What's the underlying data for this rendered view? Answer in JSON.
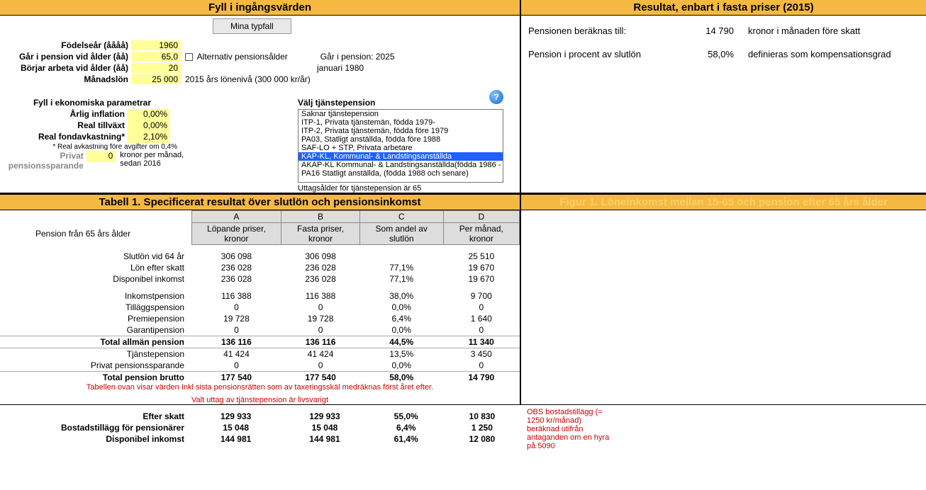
{
  "header_left": "Fyll i ingångsvärden",
  "header_right": "Resultat, enbart i fasta priser (2015)",
  "btn_typfall": "Mina typfall",
  "inputs": {
    "birth_label": "Födelseår (åååå)",
    "birth_value": "1960",
    "retire_age_label": "Går i pension vid ålder (åå)",
    "retire_age_value": "65,0",
    "alt_age_label": "Alternativ pensionsålder",
    "retire_year_label": "Går i pension: 2025",
    "work_age_label": "Börjar arbeta vid ålder (åå)",
    "work_age_value": "20",
    "work_start_note": "januari 1980",
    "salary_label": "Månadslön",
    "salary_value": "25 000",
    "salary_note": "2015 års lönenivå (300 000 kr/år)"
  },
  "params_header": "Fyll i ekonomiska parametrar",
  "params": {
    "inflation_label": "Årlig inflation",
    "inflation_value": "0,00%",
    "growth_label": "Real tillväxt",
    "growth_value": "0,00%",
    "fund_label": "Real fondavkastning*",
    "fund_value": "2,10%",
    "fund_note": "* Real avkastning före avgifter om 0,4%",
    "private_label": "Privat pensionssparande",
    "private_value": "0",
    "private_note": "kronor per månad, sedan 2016"
  },
  "tp_header": "Välj tjänstepension",
  "tp_items": [
    "Saknar tjänstepension",
    "ITP-1, Privata tjänstemän, födda 1979-",
    "ITP-2, Privata tjänstemän, födda före 1979",
    "PA03, Statligt anställda, födda före 1988",
    "SAF-LO + STP, Privata arbetare",
    "KAP-KL, Kommunal- & Landstingsanställda",
    "AKAP-KL Kommunal- & Landstingsanställda(födda 1986 -",
    "PA16 Statligt anställda, (födda 1988 och senare)"
  ],
  "tp_selected_index": 5,
  "tp_note": "Uttagsålder för tjänstepension är 65",
  "results": {
    "r1_label": "Pensionen beräknas till:",
    "r1_value": "14 790",
    "r1_desc": "kronor i månaden före skatt",
    "r2_label": "Pension i procent av slutlön",
    "r2_value": "58,0%",
    "r2_desc": "definieras som kompensationsgrad"
  },
  "table_header": "Tabell 1. Specificerat resultat över slutlön och pensionsinkomst",
  "figure_header": "Figur 1. Löneinkomst mellan 15-65 och pension efter 65  års ålder",
  "cols": {
    "a": "A",
    "b": "B",
    "c": "C",
    "d": "D",
    "a2": "Löpande priser, kronor",
    "b2": "Fasta priser, kronor",
    "c2": "Som andel av slutlön",
    "d2": "Per månad, kronor",
    "rowhead": "Pension från 65 års ålder"
  },
  "rows": {
    "slutlon": {
      "lbl": "Slutlön vid 64 år",
      "a": "306 098",
      "b": "306 098",
      "c": "",
      "d": "25 510"
    },
    "lon_skatt": {
      "lbl": "Lön efter skatt",
      "a": "236 028",
      "b": "236 028",
      "c": "77,1%",
      "d": "19 670"
    },
    "disp1": {
      "lbl": "Disponibel inkomst",
      "a": "236 028",
      "b": "236 028",
      "c": "77,1%",
      "d": "19 670"
    },
    "inkomst": {
      "lbl": "Inkomstpension",
      "a": "116 388",
      "b": "116 388",
      "c": "38,0%",
      "d": "9 700"
    },
    "tillagg": {
      "lbl": "Tilläggspension",
      "a": "0",
      "b": "0",
      "c": "0,0%",
      "d": "0"
    },
    "premie": {
      "lbl": "Premiepension",
      "a": "19 728",
      "b": "19 728",
      "c": "6,4%",
      "d": "1 640"
    },
    "garanti": {
      "lbl": "Garantipension",
      "a": "0",
      "b": "0",
      "c": "0,0%",
      "d": "0"
    },
    "tot_allman": {
      "lbl": "Total allmän pension",
      "a": "136 116",
      "b": "136 116",
      "c": "44,5%",
      "d": "11 340"
    },
    "tjanste": {
      "lbl": "Tjänstepension",
      "a": "41 424",
      "b": "41 424",
      "c": "13,5%",
      "d": "3 450"
    },
    "privat": {
      "lbl": "Privat pensionssparande",
      "a": "0",
      "b": "0",
      "c": "0,0%",
      "d": "0"
    },
    "tot_brutto": {
      "lbl": "Total pension brutto",
      "a": "177 540",
      "b": "177 540",
      "c": "58,0%",
      "d": "14 790"
    },
    "efter_skatt": {
      "lbl": "Efter skatt",
      "a": "129 933",
      "b": "129 933",
      "c": "55,0%",
      "d": "10 830"
    },
    "bostad": {
      "lbl": "Bostadstillägg för pensionärer",
      "a": "15 048",
      "b": "15 048",
      "c": "6,4%",
      "d": "1 250"
    },
    "disp2": {
      "lbl": "Disponibel inkomst",
      "a": "144 981",
      "b": "144 981",
      "c": "61,4%",
      "d": "12 080"
    }
  },
  "table_note1": "Tabellen ovan visar värden Inkl sista pensionsrätten som av taxeringsskäl medräknas först året efter.",
  "table_note2": "Valt uttag av tjänstepension är livsvarigt",
  "obs_note": "OBS bostadstillägg (= 1250 kr/månad) beräknad utifrån antaganden om en hyra på 5090"
}
